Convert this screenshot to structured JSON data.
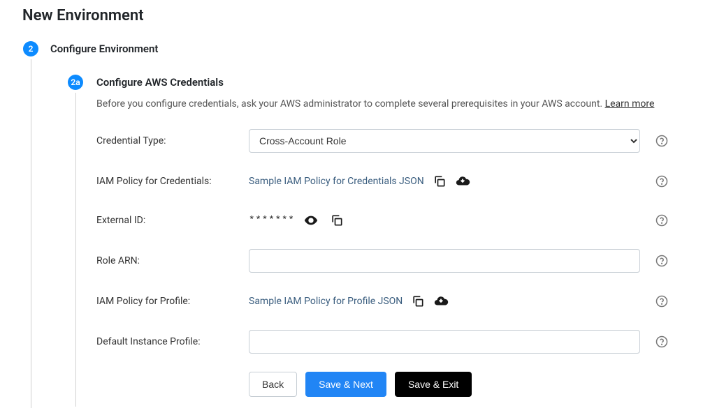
{
  "page": {
    "title": "New Environment"
  },
  "step": {
    "number": "2",
    "title": "Configure Environment"
  },
  "substep": {
    "number": "2a",
    "title": "Configure AWS Credentials",
    "intro_text": "Before you configure credentials, ask your AWS administrator to complete several prerequisites in your AWS account. ",
    "learn_more": "Learn more"
  },
  "fields": {
    "credential_type": {
      "label": "Credential Type:",
      "selected": "Cross-Account Role",
      "options": [
        "Cross-Account Role"
      ]
    },
    "iam_policy_credentials": {
      "label": "IAM Policy for Credentials:",
      "link_text": "Sample IAM Policy for Credentials JSON"
    },
    "external_id": {
      "label": "External ID:",
      "masked_value": "*******"
    },
    "role_arn": {
      "label": "Role ARN:",
      "value": ""
    },
    "iam_policy_profile": {
      "label": "IAM Policy for Profile:",
      "link_text": "Sample IAM Policy for Profile JSON"
    },
    "default_instance_profile": {
      "label": "Default Instance Profile:",
      "value": ""
    }
  },
  "actions": {
    "back": "Back",
    "save_next": "Save & Next",
    "save_exit": "Save & Exit"
  }
}
